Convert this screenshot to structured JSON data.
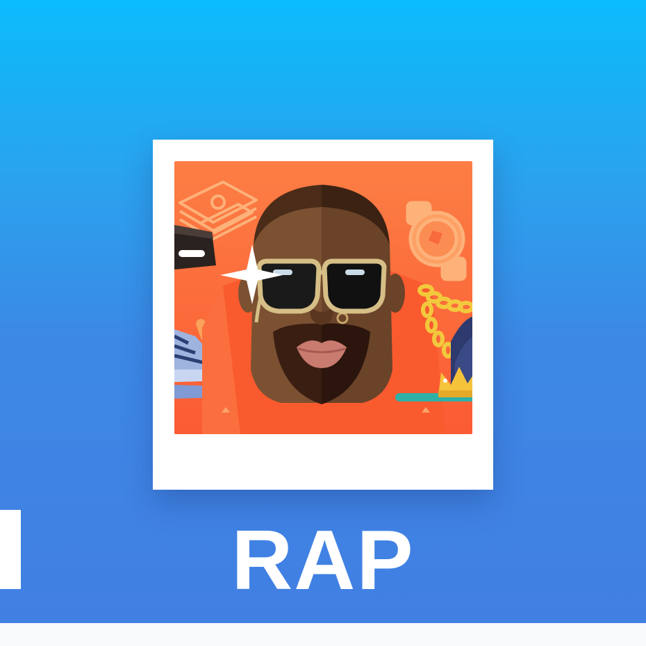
{
  "card": {
    "title": "RAP"
  },
  "colors": {
    "background_top": "#0bbcfc",
    "background_bottom": "#427fe3",
    "artwork_background": "#fb6b3a",
    "label_text": "#ffffff"
  },
  "artwork": {
    "icons": [
      "money-stack-icon",
      "boombox-icon",
      "sneaker-icon",
      "rock-hand-icon",
      "sparkle-icon",
      "watch-icon",
      "gold-chain-icon",
      "crown-icon",
      "cap-icon"
    ]
  }
}
